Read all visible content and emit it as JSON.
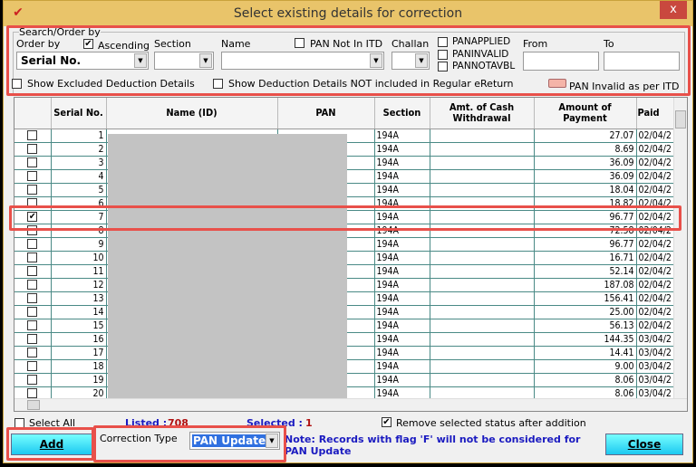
{
  "window": {
    "title": "Select existing details for correction",
    "close": "x"
  },
  "search": {
    "legend": "Search/Order by",
    "order_by_label": "Order by",
    "ascending_label": "Ascending",
    "ascending_checked": true,
    "order_by_value": "Serial No.",
    "section_label": "Section",
    "name_label": "Name",
    "pan_not_in_itd": "PAN Not In ITD",
    "challan_label": "Challan",
    "panapplied": "PANAPPLIED",
    "paninvalid": "PANINVALID",
    "pannotavbl": "PANNOTAVBL",
    "from_label": "From",
    "to_label": "To",
    "show_excluded": "Show Excluded Deduction Details",
    "show_not_included": "Show Deduction Details NOT included in Regular eReturn",
    "legend_pan_invalid": "PAN Invalid as per ITD",
    "legend_color": "#f4b4a8"
  },
  "table": {
    "columns": [
      "",
      "Serial No.",
      "Name (ID)",
      "PAN",
      "Section",
      "Amt. of Cash Withdrawal",
      "Amount of Payment",
      "Paid"
    ],
    "rows": [
      {
        "sn": "1",
        "sec": "194A",
        "amt": "27.07",
        "paid": "02/04/2",
        "checked": false
      },
      {
        "sn": "2",
        "sec": "194A",
        "amt": "8.69",
        "paid": "02/04/2",
        "checked": false
      },
      {
        "sn": "3",
        "sec": "194A",
        "amt": "36.09",
        "paid": "02/04/2",
        "checked": false
      },
      {
        "sn": "4",
        "sec": "194A",
        "amt": "36.09",
        "paid": "02/04/2",
        "checked": false
      },
      {
        "sn": "5",
        "sec": "194A",
        "amt": "18.04",
        "paid": "02/04/2",
        "checked": false
      },
      {
        "sn": "6",
        "sec": "194A",
        "amt": "18.82",
        "paid": "02/04/2",
        "checked": false
      },
      {
        "sn": "7",
        "sec": "194A",
        "amt": "96.77",
        "paid": "02/04/2",
        "checked": true
      },
      {
        "sn": "8",
        "sec": "194A",
        "amt": "72.58",
        "paid": "02/04/2",
        "checked": false
      },
      {
        "sn": "9",
        "sec": "194A",
        "amt": "96.77",
        "paid": "02/04/2",
        "checked": false
      },
      {
        "sn": "10",
        "sec": "194A",
        "amt": "16.71",
        "paid": "02/04/2",
        "checked": false
      },
      {
        "sn": "11",
        "sec": "194A",
        "amt": "52.14",
        "paid": "02/04/2",
        "checked": false
      },
      {
        "sn": "12",
        "sec": "194A",
        "amt": "187.08",
        "paid": "02/04/2",
        "checked": false
      },
      {
        "sn": "13",
        "sec": "194A",
        "amt": "156.41",
        "paid": "02/04/2",
        "checked": false
      },
      {
        "sn": "14",
        "sec": "194A",
        "amt": "25.00",
        "paid": "02/04/2",
        "checked": false
      },
      {
        "sn": "15",
        "sec": "194A",
        "amt": "56.13",
        "paid": "02/04/2",
        "checked": false
      },
      {
        "sn": "16",
        "sec": "194A",
        "amt": "144.35",
        "paid": "03/04/2",
        "checked": false
      },
      {
        "sn": "17",
        "sec": "194A",
        "amt": "14.41",
        "paid": "03/04/2",
        "checked": false
      },
      {
        "sn": "18",
        "sec": "194A",
        "amt": "9.00",
        "paid": "03/04/2",
        "checked": false
      },
      {
        "sn": "19",
        "sec": "194A",
        "amt": "8.06",
        "paid": "03/04/2",
        "checked": false
      },
      {
        "sn": "20",
        "sec": "194A",
        "amt": "8.06",
        "paid": "03/04/2",
        "checked": false
      }
    ]
  },
  "footer": {
    "select_all": "Select All",
    "listed_label": "Listed :",
    "listed_value": "708",
    "selected_label": "Selected :",
    "selected_value": "1",
    "remove_selected": "Remove selected status after addition",
    "add": "Add",
    "correction_type_label": "Correction Type",
    "correction_type_value": "PAN Update",
    "note": "Note: Records with flag 'F' will not be considered for PAN Update",
    "close": "Close"
  }
}
